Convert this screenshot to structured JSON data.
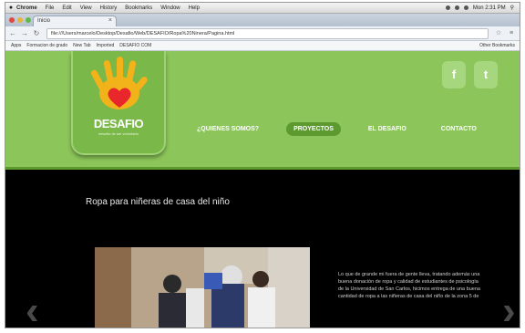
{
  "menubar": {
    "items": [
      "Chrome",
      "File",
      "Edit",
      "View",
      "History",
      "Bookmarks",
      "Window",
      "Help"
    ],
    "clock": "Mon 2:31 PM"
  },
  "browser": {
    "tab_title": "Inicio",
    "url": "file:///Users/marcelo/Desktop/Desafio/Web/DESAFIO/Ropa%20Ninera/Pagina.html",
    "bookmarks": [
      "Apps",
      "Formacion de grado",
      "New Tab",
      "Imported",
      "DESAFIO COM"
    ],
    "other_bookmarks": "Other Bookmarks"
  },
  "site": {
    "logo_text": "DESAFIO",
    "logo_sub": "desafío de ser voluntario",
    "nav": [
      "¿QUIENES SOMOS?",
      "PROYECTOS",
      "EL DESAFIO",
      "CONTACTO"
    ],
    "active_nav": "PROYECTOS",
    "social": {
      "facebook": "f",
      "twitter": "t"
    }
  },
  "content": {
    "title": "Ropa para niñeras de casa del niño",
    "paragraph": "Lo que de grande mi fuera de gente lleva, tratando además una buena donación de ropa y calidad de estudiantes de psicología de la Universidad de San Carlos, hicimos entrega de una buena cantidad de ropa a las niñeras de casa del niño de la zona 5 de",
    "arrow_left": "‹",
    "arrow_right": "›"
  },
  "colors": {
    "header_green": "#8cc65a",
    "accent_green": "#5c9a30",
    "logo_hand": "#f2b21a",
    "heart": "#e8262b",
    "body_bg": "#000000"
  }
}
